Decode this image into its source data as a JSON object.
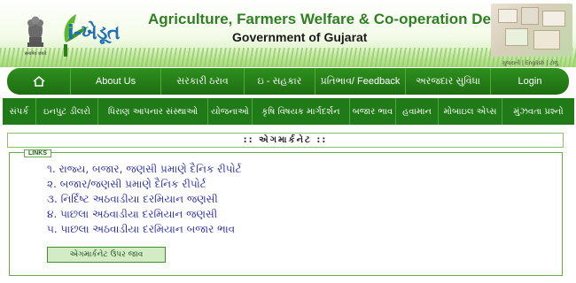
{
  "header": {
    "department_title": "Agriculture, Farmers Welfare & Co-operation Department",
    "government_title": "Government of Gujarat",
    "logo_text": "i-ખેડૂત",
    "emblem_caption": "सत्यमेव जयते",
    "language_links": "ગુજરાતી | English | ટોળું"
  },
  "top_nav": {
    "items": [
      {
        "label": "",
        "icon": "home-icon"
      },
      {
        "label": "About Us"
      },
      {
        "label": "સરકારી ઠરાવ"
      },
      {
        "label": "ઇ - સહકાર"
      },
      {
        "label": "પ્રતિભાવ/ Feedback"
      },
      {
        "label": "અરજદાર સુવિધા"
      },
      {
        "label": "Login"
      }
    ]
  },
  "sub_nav": {
    "items": [
      {
        "label": "સંપર્ક"
      },
      {
        "label": "ઇનપુટ ડીલરો"
      },
      {
        "label": "ધિરાણ આપનાર સંસ્થાઓ"
      },
      {
        "label": "યોજનાઓ"
      },
      {
        "label": "કૃષિ વિષયક માર્ગદર્શન"
      },
      {
        "label": "બજાર ભાવ"
      },
      {
        "label": "હવામાન"
      },
      {
        "label": "મોબાઇલ એપ્સ"
      },
      {
        "label": "મુંઝવતા પ્રશ્નો"
      }
    ]
  },
  "section": {
    "title": ":: એગમાર્કનેટ ::"
  },
  "links": {
    "legend": "LINKS",
    "items": [
      "૧. રાજ્ય, બજાર, જણસી પ્રમાણે દૈનિક રીપોર્ટ",
      "૨. બજાર/જણસી પ્રમાણે દૈનિક રીપોર્ટ",
      "૩. નિર્દિષ્ટ અઠવાડીયા દરમિયાન જણસી",
      "૪. પાછલા અઠવાડીયા દરમિયાન જણસી",
      "૫. પાછલા અઠવાડીયા દરમિયાન બજાર ભાવ"
    ],
    "up_button": "એગમાર્કનેટ ઉપર જાવ"
  },
  "colors": {
    "nav_green": "#1e6d12",
    "link_blue": "#2b2fa8",
    "title_green": "#2f7f22"
  }
}
